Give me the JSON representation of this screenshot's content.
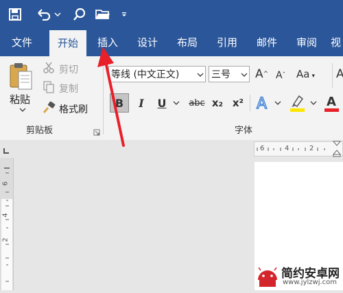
{
  "qat": {
    "icons": [
      "save-icon",
      "undo-icon",
      "dropdown-icon",
      "search-icon",
      "open-folder-icon",
      "customize-icon"
    ]
  },
  "tabs": [
    {
      "label": "文件",
      "active": false
    },
    {
      "label": "开始",
      "active": true
    },
    {
      "label": "插入",
      "active": false
    },
    {
      "label": "设计",
      "active": false
    },
    {
      "label": "布局",
      "active": false
    },
    {
      "label": "引用",
      "active": false
    },
    {
      "label": "邮件",
      "active": false
    },
    {
      "label": "审阅",
      "active": false
    },
    {
      "label": "视",
      "active": false
    }
  ],
  "clipboard": {
    "paste": "粘贴",
    "cut": "剪切",
    "copy": "复制",
    "format_painter": "格式刷",
    "group_label": "剪贴板"
  },
  "font": {
    "font_name": "等线 (中文正文)",
    "font_size": "三号",
    "grow": "A",
    "shrink": "A",
    "change_case": "Aa",
    "bold": "B",
    "italic": "I",
    "underline": "U",
    "strike": "abc",
    "subscript": "x₂",
    "superscript": "x²",
    "group_label": "字体"
  },
  "hruler": {
    "nums": [
      "6",
      "4",
      "2"
    ]
  },
  "vruler": {
    "nums": [
      "6",
      "4",
      "2"
    ]
  },
  "watermark": {
    "title": "简约安卓网",
    "url": "www.jylzwj.com"
  },
  "colors": {
    "brand": "#2b579a",
    "arrow": "#e8202a",
    "highlight": "#ffe600",
    "font_red": "#e8202a"
  }
}
